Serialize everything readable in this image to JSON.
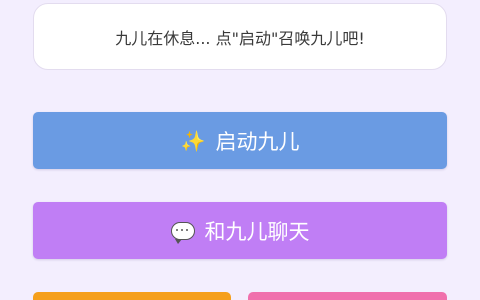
{
  "status": {
    "message": "九儿在休息... 点\"启动\"召唤九儿吧!"
  },
  "buttons": {
    "start": {
      "icon": "✨",
      "label": "启动九儿",
      "color": "#6a9be3"
    },
    "chat": {
      "icon": "speech-bubble-icon",
      "label": "和九儿聊天",
      "color": "#c07ef5"
    },
    "bottom_left": {
      "color": "#f59f1c"
    },
    "bottom_right": {
      "color": "#f070ad"
    }
  }
}
